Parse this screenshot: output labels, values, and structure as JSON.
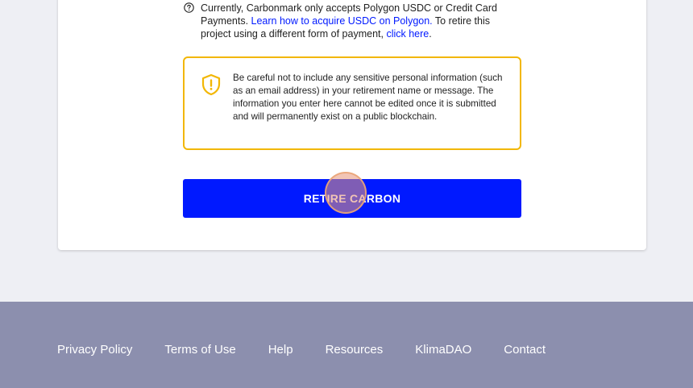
{
  "notice": {
    "text_before_link": "Currently, Carbonmark only accepts Polygon USDC or Credit Card Payments. ",
    "link_usdc": "Learn how to acquire USDC on Polygon.",
    "text_middle": " To retire this project using a different form of payment, ",
    "link_click_here": "click here",
    "text_after": "."
  },
  "warning": {
    "message": "Be careful not to include any sensitive personal information (such as an email address) in your retirement name or message. The information you enter here cannot be edited once it is submitted and will permanently exist on a public blockchain."
  },
  "retire_button": {
    "label": "RETIRE CARBON"
  },
  "footer": {
    "links": [
      "Privacy Policy",
      "Terms of Use",
      "Help",
      "Resources",
      "KlimaDAO",
      "Contact"
    ]
  },
  "colors": {
    "accent_blue": "#0019ff",
    "warning_yellow": "#f2b705",
    "footer_bg": "#8c8fae",
    "page_bg": "#eeeff4"
  },
  "icons": {
    "notice_icon": "question-circle-icon",
    "warning_icon": "shield-exclamation-icon"
  }
}
